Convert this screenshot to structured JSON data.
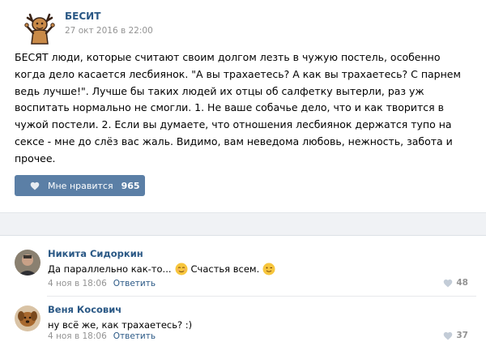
{
  "post": {
    "author": "БЕСИТ",
    "date": "27 окт 2016 в 22:00",
    "avatar_icon": "deer-icon",
    "text": "БЕСЯТ люди, которые считают своим долгом лезть в чужую постель, особенно когда дело касается лесбиянок. \"А вы трахаетесь? А как вы трахаетесь? С парнем ведь лучше!\". Лучше бы таких людей их отцы об салфетку вытерли, раз уж воспитать нормально не смогли. 1. Не ваше собачье дело, что и как творится в чужой постели. 2. Если вы думаете, что отношения лесбиянок держатся тупо на сексе - мне до слёз вас жаль. Видимо, вам неведома любовь, нежность, забота и прочее.",
    "like_label": "Мне нравится",
    "like_count": "965",
    "accent_color": "#5b7fa6"
  },
  "comments": [
    {
      "author": "Никита Сидоркин",
      "text_part1": "Да параллельно как-то...",
      "text_part2": "Счастья всем.",
      "emoji1": "relieved-face-emoji",
      "emoji2": "winking-face-emoji",
      "date": "4 ноя в 18:06",
      "reply_label": "Ответить",
      "likes": "48"
    },
    {
      "author": "Веня Косович",
      "text": "ну всё же, как трахаетесь? :)",
      "date": "4 ноя в 18:06",
      "reply_label": "Ответить",
      "likes": "37"
    }
  ],
  "colors": {
    "link": "#2a5885",
    "muted": "#939393",
    "band": "#f0f2f5"
  }
}
